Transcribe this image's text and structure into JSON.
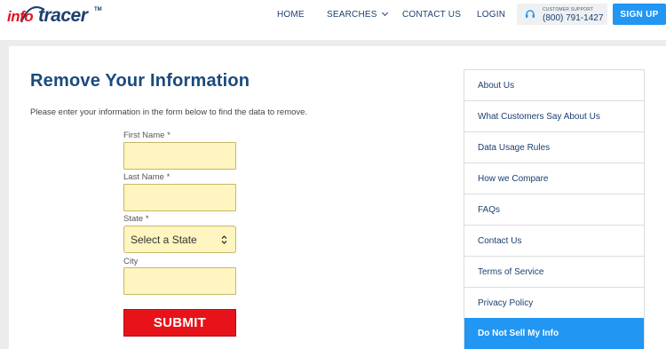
{
  "brand": {
    "part1": "info",
    "part2": "tracer",
    "tm": "TM"
  },
  "nav": {
    "home": "HOME",
    "searches": "SEARCHES",
    "contact": "CONTACT US",
    "login": "LOGIN"
  },
  "support": {
    "label": "CUSTOMER SUPPORT",
    "phone": "(800) 791-1427"
  },
  "signup": "SIGN UP",
  "main": {
    "title": "Remove Your Information",
    "intro": "Please enter your information in the form below to find the data to remove.",
    "form": {
      "first_name_label": "First Name *",
      "first_name_value": "",
      "last_name_label": "Last Name *",
      "last_name_value": "",
      "state_label": "State *",
      "state_selected": "Select a State",
      "city_label": "City",
      "city_value": "",
      "submit": "SUBMIT"
    }
  },
  "sidebar": {
    "items": [
      {
        "label": "About Us"
      },
      {
        "label": "What Customers Say About Us"
      },
      {
        "label": "Data Usage Rules"
      },
      {
        "label": "How we Compare"
      },
      {
        "label": "FAQs"
      },
      {
        "label": "Contact Us"
      },
      {
        "label": "Terms of Service"
      },
      {
        "label": "Privacy Policy"
      },
      {
        "label": "Do Not Sell My Info",
        "active": true
      }
    ]
  },
  "colors": {
    "brand_red": "#e3141e",
    "brand_navy": "#1b3f70",
    "accent_blue": "#2196f3",
    "submit_red": "#e8131a",
    "input_fill": "#fef5c0"
  }
}
